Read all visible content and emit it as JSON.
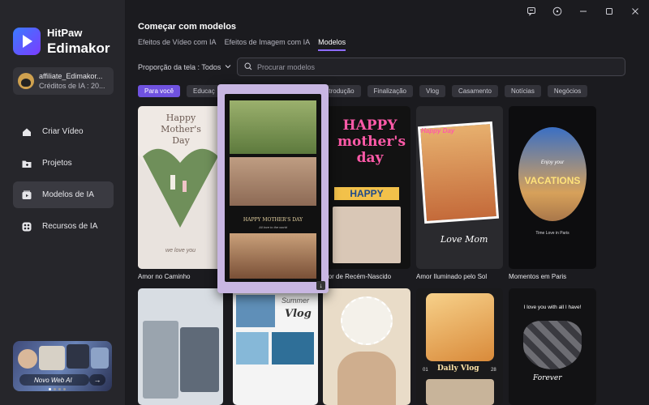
{
  "brand": {
    "line1": "HitPaw",
    "line2": "Edimakor"
  },
  "account": {
    "name": "affiliate_Edimakor...",
    "credits": "Créditos de IA : 20..."
  },
  "nav": {
    "items": [
      {
        "label": "Criar Vídeo",
        "icon": "home-icon"
      },
      {
        "label": "Projetos",
        "icon": "folder-icon"
      },
      {
        "label": "Modelos de IA",
        "icon": "template-icon",
        "active": true
      },
      {
        "label": "Recursos de IA",
        "icon": "ai-features-icon"
      }
    ]
  },
  "promo": {
    "label": "Novo Web AI",
    "arrow": "→"
  },
  "window_controls": [
    "feedback-icon",
    "info-icon",
    "minimize-icon",
    "maximize-icon",
    "close-icon"
  ],
  "main": {
    "title": "Começar com modelos",
    "tabs": [
      {
        "label": "Efeitos de Vídeo com IA"
      },
      {
        "label": "Efeitos de Imagem com IA"
      },
      {
        "label": "Modelos",
        "active": true
      }
    ],
    "ratio_label": "Proporção da tela : Todos",
    "search_placeholder": "Procurar modelos",
    "chips": [
      {
        "label": "Para você",
        "active": true
      },
      {
        "label": "Educaç"
      },
      {
        "label": "Introdução"
      },
      {
        "label": "Finalização"
      },
      {
        "label": "Vlog"
      },
      {
        "label": "Casamento"
      },
      {
        "label": "Notícias"
      },
      {
        "label": "Negócios"
      }
    ],
    "templates_row1": [
      {
        "title": "Amor no Caminho",
        "overlay_top": "Happy Mother's Day",
        "overlay_bottom": "we love you"
      },
      {
        "title": "mor de Recém-Nascido",
        "overlay_top": "HAPPY mother's day",
        "overlay_mid": "HAPPY"
      },
      {
        "title": "Amor Iluminado pelo Sol",
        "overlay_top": "Happy Day",
        "overlay_bottom": "Love Mom"
      },
      {
        "title": "Momentos em Paris",
        "overlay_mid": "VACATIONS",
        "overlay_small": "Enjoy your",
        "overlay_bottom": "Time Love in Paris"
      }
    ],
    "hover_template": {
      "banner": "HAPPY MOTHER'S DAY",
      "caption": "All love to the world"
    },
    "templates_row2": [
      {
        "overlay": ""
      },
      {
        "overlay_top": "Summer",
        "overlay_mid": "Vlog"
      },
      {
        "overlay": ""
      },
      {
        "overlay_bottom": "Daily Vlog",
        "overlay_left": "01",
        "overlay_right": "28"
      },
      {
        "overlay_top": "I love you with all I have!",
        "overlay_bottom": "Forever"
      }
    ]
  }
}
